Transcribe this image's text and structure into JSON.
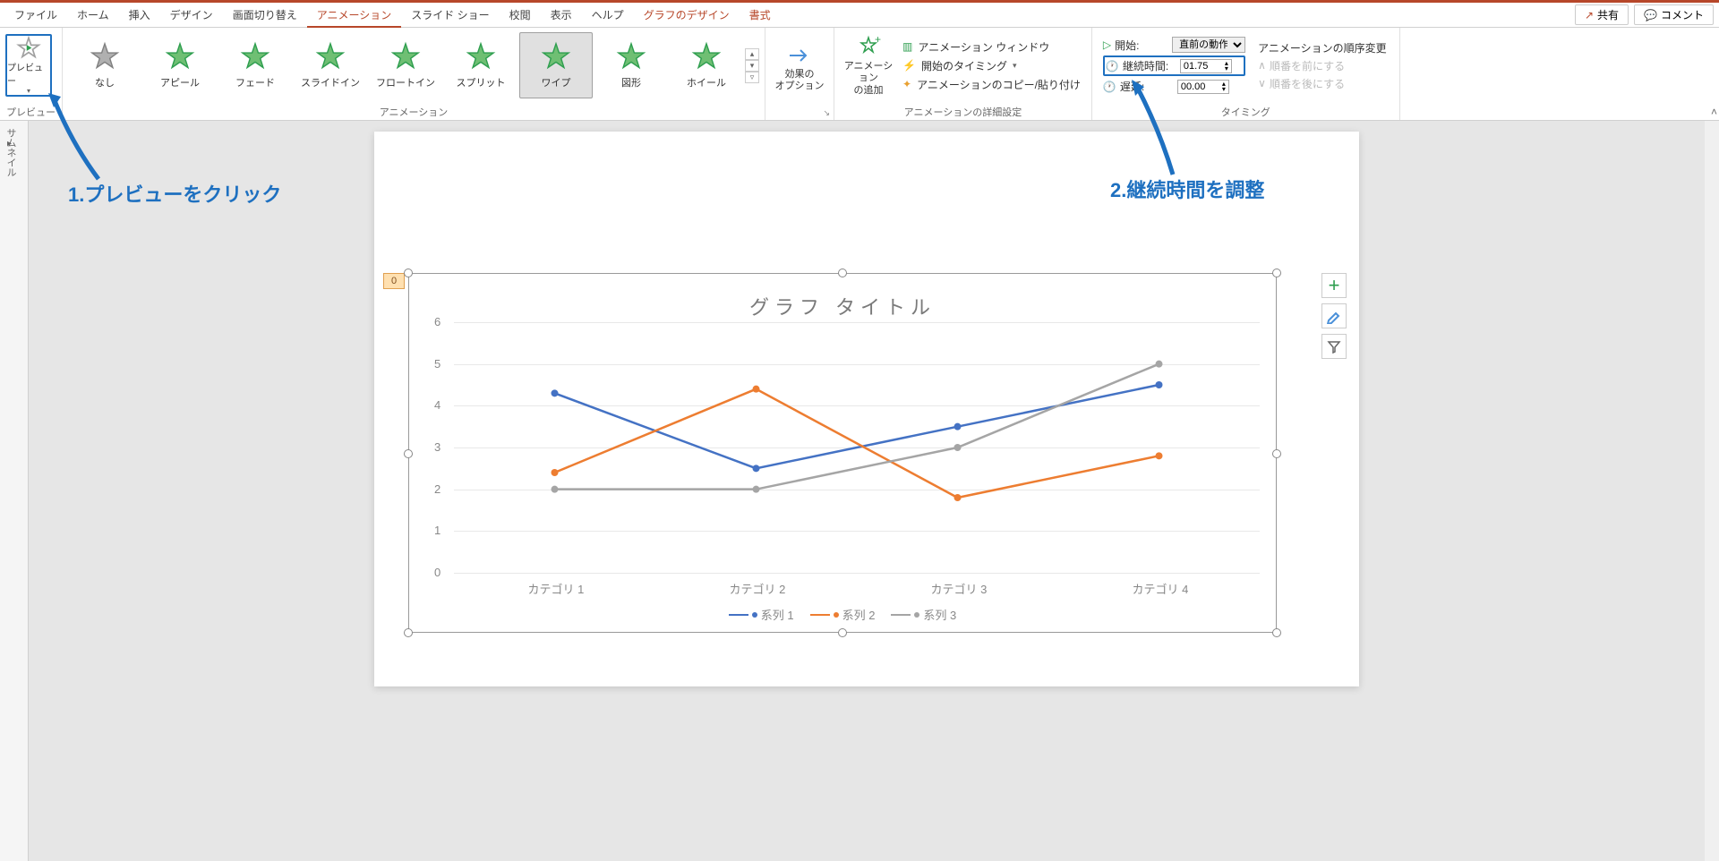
{
  "tabs": {
    "file": "ファイル",
    "home": "ホーム",
    "insert": "挿入",
    "design": "デザイン",
    "transition": "画面切り替え",
    "animation": "アニメーション",
    "slideshow": "スライド ショー",
    "review": "校閲",
    "view": "表示",
    "help": "ヘルプ",
    "chartdesign": "グラフのデザイン",
    "format": "書式",
    "share": "共有",
    "comment": "コメント"
  },
  "ribbon": {
    "preview": {
      "label": "プレビュー",
      "group": "プレビュー"
    },
    "animations": {
      "group": "アニメーション",
      "items": [
        "なし",
        "アピール",
        "フェード",
        "スライドイン",
        "フロートイン",
        "スプリット",
        "ワイプ",
        "図形",
        "ホイール"
      ],
      "selected": 6
    },
    "effect_options": "効果の\nオプション",
    "add_anim": "アニメーション\nの追加",
    "advanced": {
      "group": "アニメーションの詳細設定",
      "pane": "アニメーション ウィンドウ",
      "trigger": "開始のタイミング",
      "painter": "アニメーションのコピー/貼り付け"
    },
    "timing": {
      "group": "タイミング",
      "start_label": "開始:",
      "start_value": "直前の動作…",
      "duration_label": "継続時間:",
      "duration_value": "01.75",
      "delay_label": "遅延:",
      "delay_value": "00.00",
      "reorder_label": "アニメーションの順序変更",
      "reorder_prev": "順番を前にする",
      "reorder_next": "順番を後にする"
    }
  },
  "thumbnails_label": "サムネイル",
  "anim_tag": "0",
  "annotations": {
    "a1": "1.プレビューをクリック",
    "a2": "2.継続時間を調整"
  },
  "chart_btns": {
    "plus": "+",
    "brush": "brush",
    "filter": "filter"
  },
  "chart_data": {
    "type": "line",
    "title": "グラフ タイトル",
    "categories": [
      "カテゴリ 1",
      "カテゴリ 2",
      "カテゴリ 3",
      "カテゴリ 4"
    ],
    "series": [
      {
        "name": "系列 1",
        "color": "#4472c4",
        "values": [
          4.3,
          2.5,
          3.5,
          4.5
        ]
      },
      {
        "name": "系列 2",
        "color": "#ed7d31",
        "values": [
          2.4,
          4.4,
          1.8,
          2.8
        ]
      },
      {
        "name": "系列 3",
        "color": "#a5a5a5",
        "values": [
          2.0,
          2.0,
          3.0,
          5.0
        ]
      }
    ],
    "ylim": [
      0,
      6
    ],
    "yticks": [
      0,
      1,
      2,
      3,
      4,
      5,
      6
    ]
  }
}
